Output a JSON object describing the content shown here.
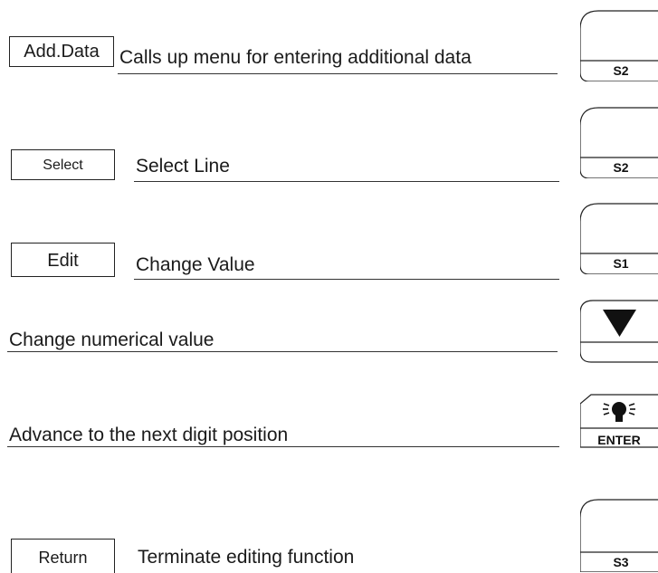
{
  "rows": [
    {
      "softkey": "Add.Data",
      "description": "Calls up menu for entering additional data",
      "key": "S2"
    },
    {
      "softkey": "Select",
      "description": "Select Line",
      "key": "S2"
    },
    {
      "softkey": "Edit",
      "description": "Change Value",
      "key": "S1"
    },
    {
      "description": "Change numerical value",
      "key_icon": "down-triangle-icon"
    },
    {
      "description": "Advance to the next digit position",
      "key": "ENTER",
      "key_icon": "lamp-icon"
    },
    {
      "softkey": "Return",
      "description": "Terminate editing function",
      "key": "S3"
    }
  ]
}
